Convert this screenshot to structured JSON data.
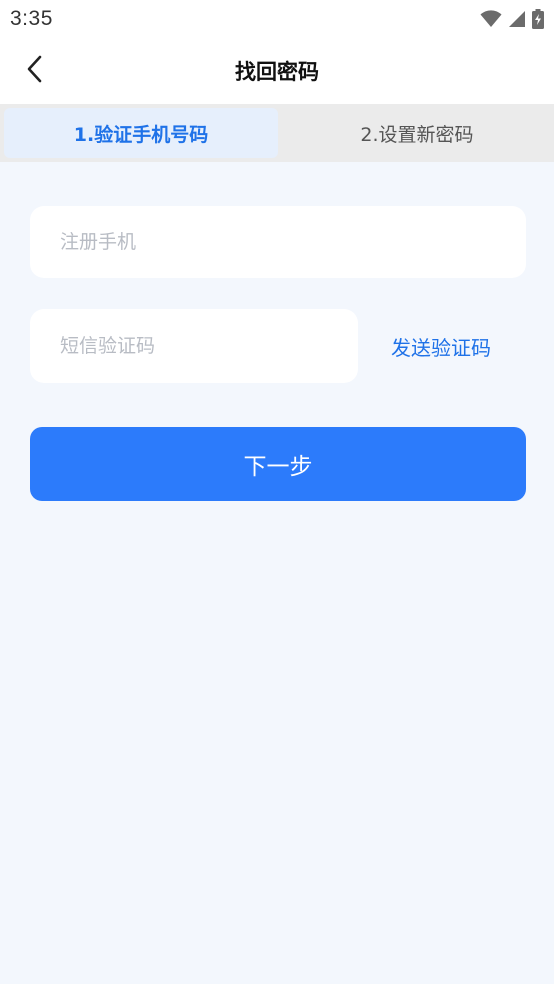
{
  "status_bar": {
    "time": "3:35",
    "icons": [
      "wifi-icon",
      "cellular-signal-icon",
      "battery-charging-icon"
    ]
  },
  "header": {
    "back_icon": "chevron-left-icon",
    "title": "找回密码"
  },
  "tabs": [
    {
      "label": "1.验证手机号码",
      "active": true
    },
    {
      "label": "2.设置新密码",
      "active": false
    }
  ],
  "form": {
    "phone_placeholder": "注册手机",
    "phone_value": "",
    "code_placeholder": "短信验证码",
    "code_value": "",
    "send_code_label": "发送验证码",
    "next_label": "下一步"
  },
  "colors": {
    "accent": "#2c7bfb",
    "accent_text": "#1f72e8",
    "page_background": "#f3f7fd",
    "tab_background": "#ebebeb",
    "active_tab_background": "#e6effc"
  }
}
